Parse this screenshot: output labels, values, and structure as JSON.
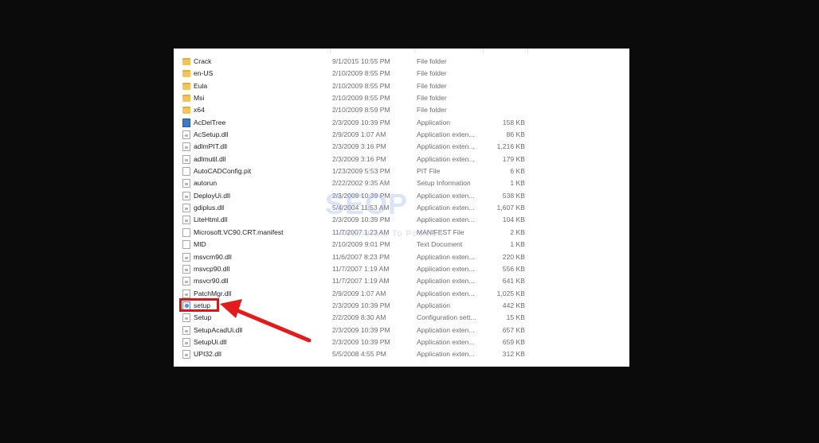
{
  "colors": {
    "background": "#0b0b0b",
    "panel": "#ffffff",
    "highlight": "#d11a1a",
    "arrow": "#e31b1b"
  },
  "files": [
    {
      "name": "Crack",
      "date": "9/1/2015 10:55 PM",
      "type": "File folder",
      "size": "",
      "icon": "folder-icon"
    },
    {
      "name": "en-US",
      "date": "2/10/2009 8:55 PM",
      "type": "File folder",
      "size": "",
      "icon": "folder-icon"
    },
    {
      "name": "Eula",
      "date": "2/10/2009 8:55 PM",
      "type": "File folder",
      "size": "",
      "icon": "folder-icon"
    },
    {
      "name": "Msi",
      "date": "2/10/2009 8:55 PM",
      "type": "File folder",
      "size": "",
      "icon": "folder-icon"
    },
    {
      "name": "x64",
      "date": "2/10/2009 8:59 PM",
      "type": "File folder",
      "size": "",
      "icon": "folder-icon"
    },
    {
      "name": "AcDelTree",
      "date": "2/3/2009 10:39 PM",
      "type": "Application",
      "size": "158 KB",
      "icon": "app-icon"
    },
    {
      "name": "AcSetup.dll",
      "date": "2/9/2009 1:07 AM",
      "type": "Application exten...",
      "size": "86 KB",
      "icon": "dll-icon"
    },
    {
      "name": "adlmPIT.dll",
      "date": "2/3/2009 3:16 PM",
      "type": "Application exten...",
      "size": "1,216 KB",
      "icon": "dll-icon"
    },
    {
      "name": "adlmutil.dll",
      "date": "2/3/2009 3:16 PM",
      "type": "Application exten...",
      "size": "179 KB",
      "icon": "dll-icon"
    },
    {
      "name": "AutoCADConfig.pit",
      "date": "1/23/2009 5:53 PM",
      "type": "PIT File",
      "size": "6 KB",
      "icon": "file-icon"
    },
    {
      "name": "autorun",
      "date": "2/22/2002 9:35 AM",
      "type": "Setup Information",
      "size": "1 KB",
      "icon": "settings-file-icon"
    },
    {
      "name": "DeployUi.dll",
      "date": "2/3/2009 10:39 PM",
      "type": "Application exten...",
      "size": "538 KB",
      "icon": "dll-icon"
    },
    {
      "name": "gdiplus.dll",
      "date": "5/4/2004 11:53 AM",
      "type": "Application exten...",
      "size": "1,607 KB",
      "icon": "dll-icon"
    },
    {
      "name": "LiteHtml.dll",
      "date": "2/3/2009 10:39 PM",
      "type": "Application exten...",
      "size": "104 KB",
      "icon": "dll-icon"
    },
    {
      "name": "Microsoft.VC90.CRT.manifest",
      "date": "11/7/2007 1:23 AM",
      "type": "MANIFEST File",
      "size": "2 KB",
      "icon": "file-icon"
    },
    {
      "name": "MID",
      "date": "2/10/2009 9:01 PM",
      "type": "Text Document",
      "size": "1 KB",
      "icon": "text-file-icon"
    },
    {
      "name": "msvcm90.dll",
      "date": "11/6/2007 8:23 PM",
      "type": "Application exten...",
      "size": "220 KB",
      "icon": "dll-icon"
    },
    {
      "name": "msvcp90.dll",
      "date": "11/7/2007 1:19 AM",
      "type": "Application exten...",
      "size": "556 KB",
      "icon": "dll-icon"
    },
    {
      "name": "msvcr90.dll",
      "date": "11/7/2007 1:19 AM",
      "type": "Application exten...",
      "size": "641 KB",
      "icon": "dll-icon"
    },
    {
      "name": "PatchMgr.dll",
      "date": "2/9/2009 1:07 AM",
      "type": "Application exten...",
      "size": "1,025 KB",
      "icon": "dll-icon"
    },
    {
      "name": "setup",
      "date": "2/3/2009 10:39 PM",
      "type": "Application",
      "size": "442 KB",
      "icon": "setup-app-icon"
    },
    {
      "name": "Setup",
      "date": "2/2/2009 8:30 AM",
      "type": "Configuration sett...",
      "size": "15 KB",
      "icon": "settings-file-icon"
    },
    {
      "name": "SetupAcadUi.dll",
      "date": "2/3/2009 10:39 PM",
      "type": "Application exten...",
      "size": "657 KB",
      "icon": "dll-icon"
    },
    {
      "name": "SetupUi.dll",
      "date": "2/3/2009 10:39 PM",
      "type": "Application exten...",
      "size": "659 KB",
      "icon": "dll-icon"
    },
    {
      "name": "UPI32.dll",
      "date": "5/5/2008 4:55 PM",
      "type": "Application exten...",
      "size": "312 KB",
      "icon": "dll-icon"
    }
  ],
  "watermark": {
    "logo": "SEOP",
    "tagline": "Accelerate To Position"
  }
}
